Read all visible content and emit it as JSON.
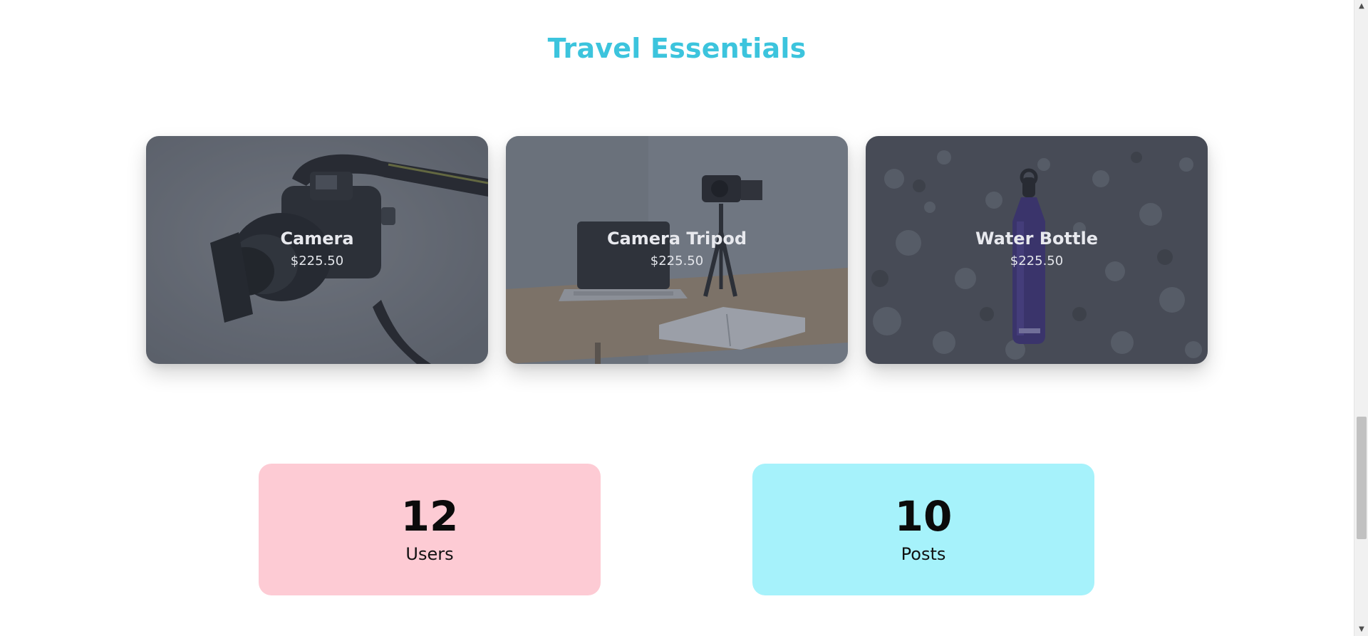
{
  "section": {
    "title": "Travel Essentials"
  },
  "products": [
    {
      "name": "Camera",
      "price": "$225.50",
      "icon": "camera-photo"
    },
    {
      "name": "Camera Tripod",
      "price": "$225.50",
      "icon": "tripod-desk-photo"
    },
    {
      "name": "Water Bottle",
      "price": "$225.50",
      "icon": "water-bottle-photo"
    }
  ],
  "stats": [
    {
      "value": "12",
      "label": "Users",
      "color": "#fdcbd4"
    },
    {
      "value": "10",
      "label": "Posts",
      "color": "#a6f2fb"
    }
  ],
  "theme": {
    "accent": "#3cc4dd",
    "top_bar": "#1d4f91"
  },
  "scrollbar": {
    "position": 0.78
  }
}
